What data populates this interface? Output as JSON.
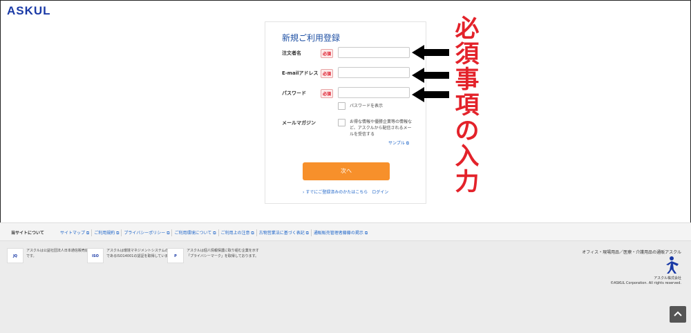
{
  "brand": "ASKUL",
  "form": {
    "title": "新規ご利用登録",
    "required_badge": "必須",
    "fields": [
      {
        "label": "注文者名"
      },
      {
        "label": "E-mailアドレス"
      },
      {
        "label": "パスワード"
      }
    ],
    "show_password_label": "パスワードを表示",
    "mail_magazine_label": "メールマガジン",
    "mail_magazine_text": "お得な情報や優勝企業等の情報など、アスクルから配信されるメールを受信する",
    "sample_link": "サンプル ⧉",
    "next_button": "次へ",
    "login_link": "すでにご登録済みのかたはこちら　ログイン"
  },
  "annotation": {
    "chars": [
      "必",
      "須",
      "事",
      "項",
      "の",
      "入",
      "力"
    ]
  },
  "nav": {
    "title": "当サイトについて",
    "links": [
      "サイトマップ ⧉",
      "ご利用規約 ⧉",
      "プライバシーポリシー ⧉",
      "ご利用環境について ⧉",
      "ご利用上の注意 ⧉",
      "古物営業法に基づく表記 ⧉",
      "通販販売管理者藤藤の掲示 ⧉"
    ]
  },
  "footer": {
    "certs": [
      {
        "logo": "JQ",
        "text": "アスクルは公益社団法人日本通信販売協会の会員です。"
      },
      {
        "logo": "ISO",
        "text": "アスクルは環境マネジメントシステムの国際規格であるISO14001の認証を取得しています。"
      },
      {
        "logo": "P",
        "text": "アスクルは個人情報保護に取り組む企業を示す「プライバシーマーク」を取得しております。"
      }
    ],
    "right_title": "オフィス・現場用品／医療・介護用品の通販アスクル",
    "corp_name": "アスクル株式会社",
    "copyright": "©ASKUL Corporation. All rights reserved."
  },
  "colors": {
    "brand": "#1a3aa6",
    "accent": "#f7902b",
    "annotation": "#e3222a",
    "link": "#1d64c8"
  }
}
